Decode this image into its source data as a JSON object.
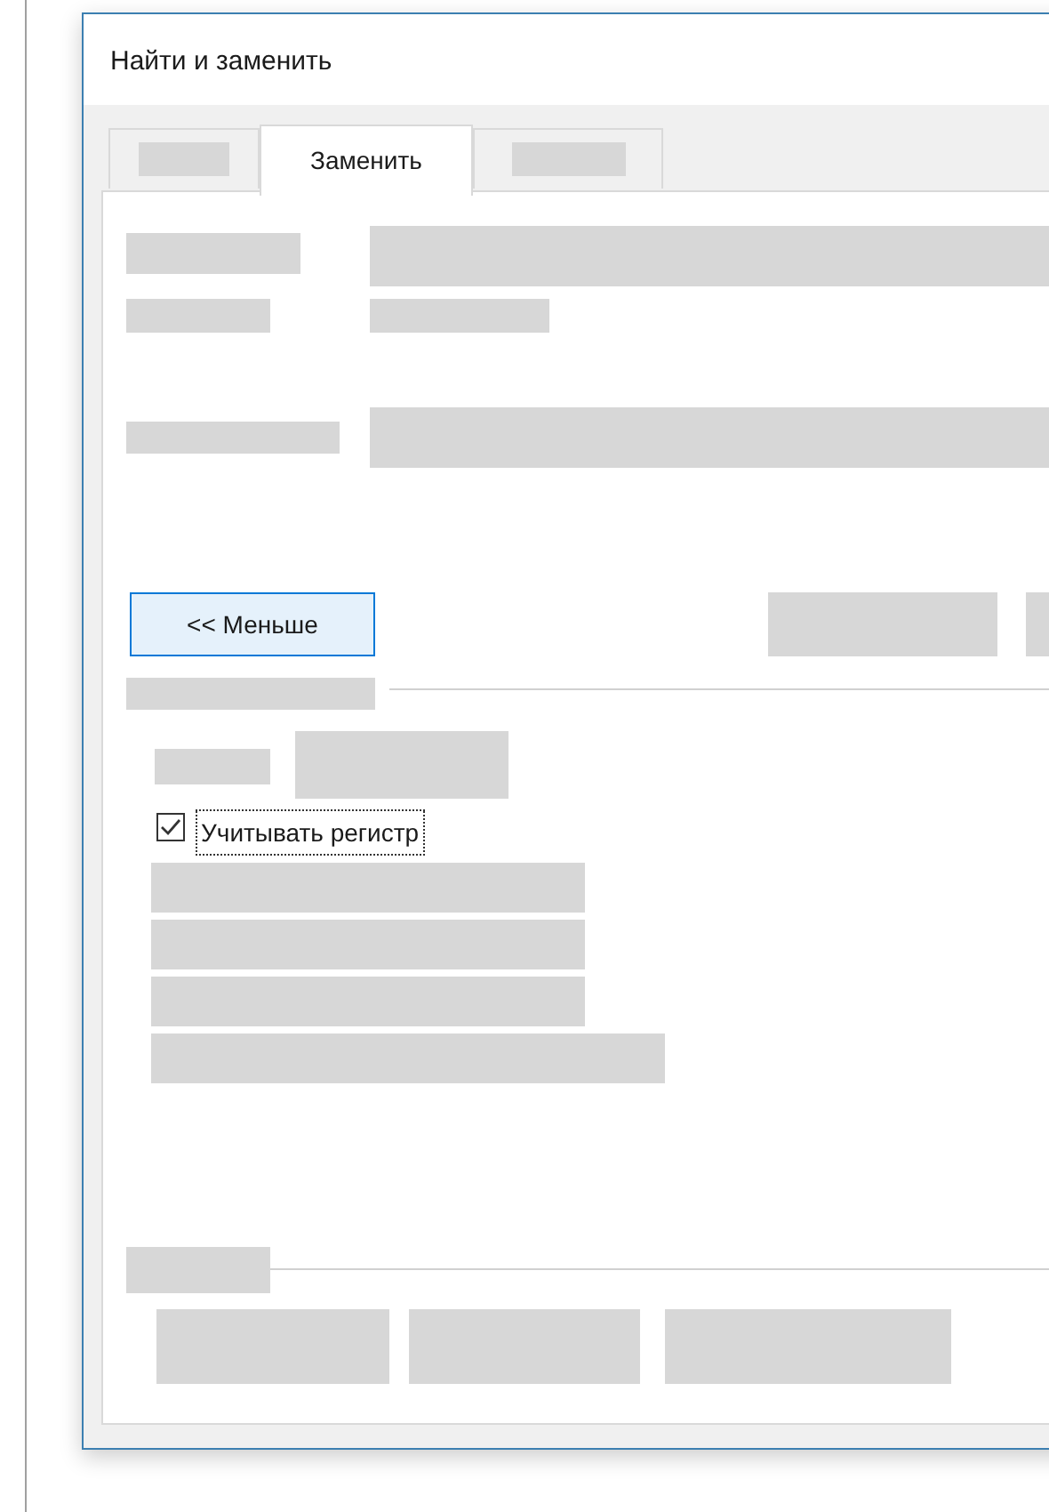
{
  "window": {
    "title": "Найти и заменить"
  },
  "tabs": [
    {
      "kind": "redacted",
      "selected": false
    },
    {
      "kind": "text",
      "label": "Заменить",
      "selected": true
    },
    {
      "kind": "redacted",
      "selected": false
    }
  ],
  "less_button": "<< Меньше",
  "options": [
    {
      "label": "Учитывать регистр",
      "checked": true
    }
  ]
}
